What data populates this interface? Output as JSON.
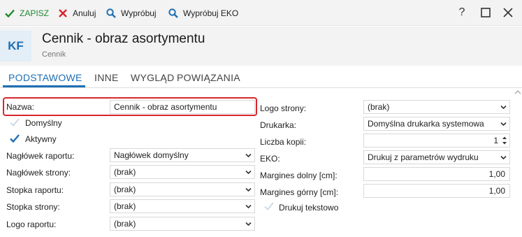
{
  "toolbar": {
    "save_label": "ZAPISZ",
    "cancel_label": "Anuluj",
    "try_label": "Wypróbuj",
    "try_eko_label": "Wypróbuj EKO",
    "help_glyph": "?",
    "colors": {
      "save": "#1f8a2e",
      "cancel": "#d9262c",
      "search": "#1f6fb4"
    },
    "icons": [
      "check-icon",
      "x-icon",
      "search-icon",
      "search-icon",
      "help-icon",
      "maximize-icon",
      "close-icon"
    ]
  },
  "header": {
    "badge": "KF",
    "title": "Cennik - obraz asortymentu",
    "subtitle": "Cennik"
  },
  "tabs": [
    {
      "label": "PODSTAWOWE",
      "active": true
    },
    {
      "label": "INNE",
      "active": false
    },
    {
      "label": "WYGLĄD",
      "active": false
    },
    {
      "label": "POWIĄZANIA",
      "active": false
    }
  ],
  "accent_color": "#1f6fb4",
  "highlight_color": "#d9262c",
  "left": {
    "nazwa": {
      "label": "Nazwa:",
      "value": "Cennik - obraz asortymentu"
    },
    "domyslny": {
      "label": "Domyślny",
      "checked": false
    },
    "aktywny": {
      "label": "Aktywny",
      "checked": true
    },
    "naglowek_raportu": {
      "label": "Nagłówek raportu:",
      "value": "Nagłówek domyślny"
    },
    "naglowek_strony": {
      "label": "Nagłówek strony:",
      "value": "(brak)"
    },
    "stopka_raportu": {
      "label": "Stopka raportu:",
      "value": "(brak)"
    },
    "stopka_strony": {
      "label": "Stopka strony:",
      "value": "(brak)"
    },
    "logo_raportu": {
      "label": "Logo raportu:",
      "value": "(brak)"
    }
  },
  "right": {
    "logo_strony": {
      "label": "Logo strony:",
      "value": "(brak)"
    },
    "drukarka": {
      "label": "Drukarka:",
      "value": "Domyślna drukarka systemowa"
    },
    "liczba_kopii": {
      "label": "Liczba kopii:",
      "value": "1"
    },
    "eko": {
      "label": "EKO:",
      "value": "Drukuj z parametrów wydruku"
    },
    "margines_dolny": {
      "label": "Margines dolny [cm]:",
      "value": "1,00"
    },
    "margines_gorny": {
      "label": "Margines górny [cm]:",
      "value": "1,00"
    },
    "drukuj_tekstowo": {
      "label": "Drukuj tekstowo",
      "checked": false
    }
  }
}
